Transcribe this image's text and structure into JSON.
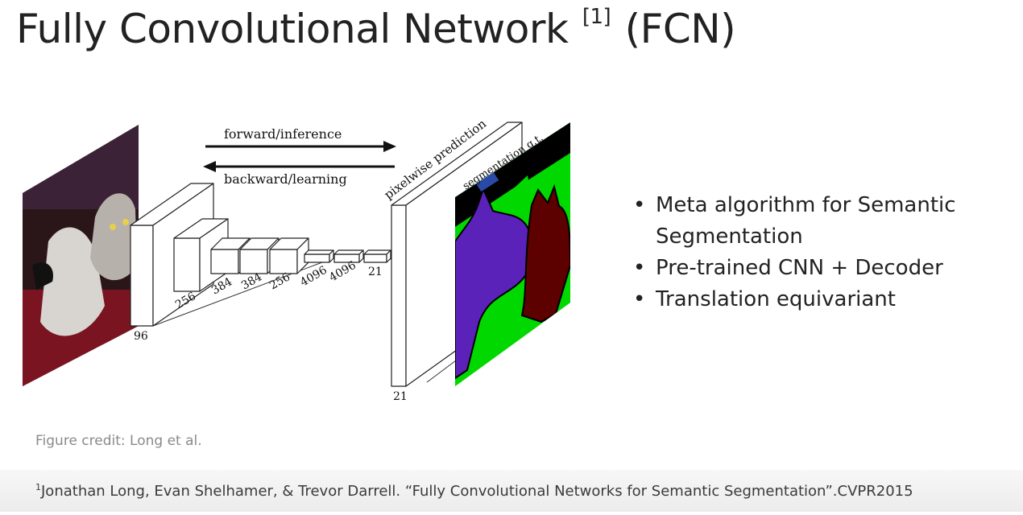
{
  "slide": {
    "title_main": "Fully Convolutional Network",
    "title_ref": "[1]",
    "title_suffix": "(FCN)"
  },
  "figure": {
    "forward_label": "forward/inference",
    "backward_label": "backward/learning",
    "prediction_label": "pixelwise prediction",
    "gt_label": "segmentation g.t.",
    "layer_labels": [
      "96",
      "256",
      "384",
      "384",
      "256",
      "4096",
      "4096",
      "21"
    ],
    "output_label": "21",
    "colors": {
      "segmentation_bg": "#00d800",
      "class_dog": "#5a22b8",
      "class_cat": "#5c0000",
      "boundary": "#000000"
    }
  },
  "bullets": [
    "Meta algorithm for Semantic Segmentation",
    "Pre-trained CNN + Decoder",
    "Translation equivariant"
  ],
  "credit": "Figure credit: Long et al.",
  "reference": {
    "marker": "1",
    "text": "Jonathan Long, Evan Shelhamer, & Trevor Darrell. “Fully Convolutional Networks for Semantic Segmentation”.CVPR2015"
  }
}
